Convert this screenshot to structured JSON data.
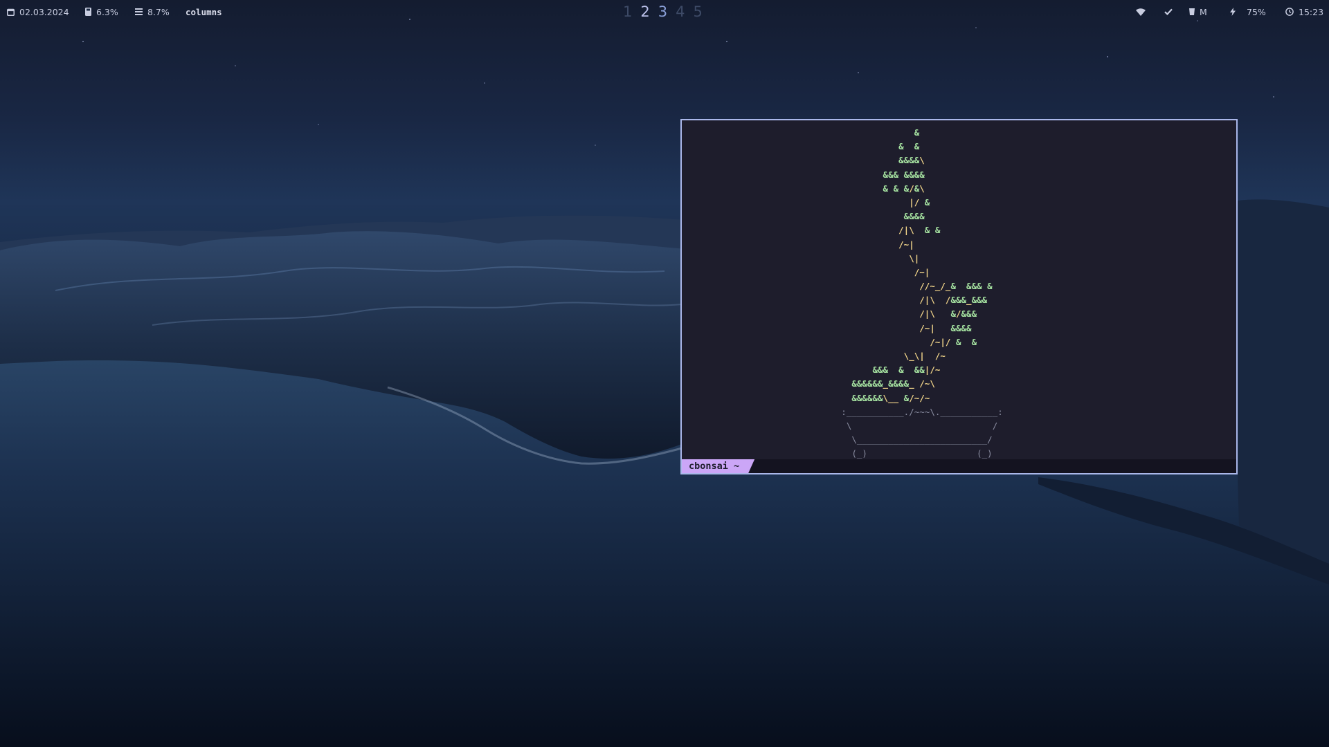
{
  "topbar": {
    "date": "02.03.2024",
    "disk": "6.3%",
    "memory": "8.7%",
    "layout": "columns",
    "workspaces": [
      "1",
      "2",
      "3",
      "4",
      "5"
    ],
    "workspace_states": [
      "empty",
      "occupied",
      "focused",
      "empty",
      "empty"
    ],
    "vpn": "M",
    "battery": "75%",
    "time": "15:23",
    "icons": [
      "calendar-icon",
      "disk-icon",
      "memory-icon",
      "wifi-icon",
      "check-icon",
      "vpn-icon",
      "bolt-icon",
      "clock-icon"
    ]
  },
  "terminal": {
    "session_label": "cbonsai ~",
    "bonsai_lines": [
      "                                       &",
      "                                    &  &",
      "                                    &&&&\\",
      "                                 &&& &&&&",
      "                                 & & &/&\\",
      "                                      |/ &",
      "                                     &&&&",
      "                                    /|\\  & &",
      "                                    /~|",
      "                                      \\|",
      "                                       /~|",
      "                                        //~_/_&  &&& &",
      "                                        /|\\  /&&&_&&&",
      "                                        /|\\   &/&&&",
      "                                        /~|   &&&&",
      "                                          /~|/ &  &",
      "                                     \\_\\|  /~",
      "                               &&&  &  &&|/~",
      "                           &&&&&&_&&&&_ /~\\",
      "                           &&&&&&\\__ &/~/~",
      "                         :___________./~~~\\.___________:",
      "                          \\                           /",
      "                           \\_________________________/",
      "                           (_)                     (_)"
    ]
  },
  "colors": {
    "terminal_bg": "#1e1d2c",
    "terminal_border": "#aab7ea",
    "leaves": "#a6e3a1",
    "trunk": "#f2d58a",
    "pot": "#8b8ea2",
    "session_tab": "#cba6f7"
  }
}
